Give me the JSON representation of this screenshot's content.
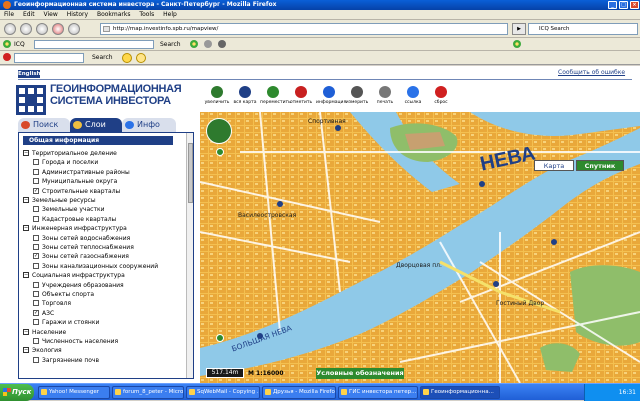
{
  "window": {
    "title": "Геоинформационная система инвестора - Санкт-Петербург - Mozilla Firefox"
  },
  "menu": [
    "File",
    "Edit",
    "View",
    "History",
    "Bookmarks",
    "Tools",
    "Help"
  ],
  "nav": {
    "url": "http://map.investinfo.spb.ru/mapview/",
    "search_placeholder": "ICQ Search"
  },
  "icq_bar": {
    "label": "ICQ",
    "search_label": "Search"
  },
  "bar3": {
    "search_label": "Search"
  },
  "page": {
    "english_label": "English",
    "report_error": "Сообщить об ошибке",
    "logo_line1": "ГЕОИНФОРМАЦИОННАЯ",
    "logo_line2": "СИСТЕМА ИНВЕСТОРА"
  },
  "tabs": [
    {
      "label": "Поиск",
      "active": false
    },
    {
      "label": "Слои",
      "active": true
    },
    {
      "label": "Инфо",
      "active": false
    }
  ],
  "layers": {
    "header": "Общая информация",
    "groups": [
      {
        "label": "Территориальное деление",
        "items": [
          {
            "label": "Города и поселки",
            "checked": false
          },
          {
            "label": "Административные районы",
            "checked": false
          },
          {
            "label": "Муниципальные округа",
            "checked": false
          },
          {
            "label": "Строительные кварталы",
            "checked": true
          }
        ]
      },
      {
        "label": "Земельные ресурсы",
        "items": [
          {
            "label": "Земельные участки",
            "checked": false
          },
          {
            "label": "Кадастровые кварталы",
            "checked": false
          }
        ]
      },
      {
        "label": "Инженерная инфраструктура",
        "items": [
          {
            "label": "Зоны сетей водоснабжения",
            "checked": false
          },
          {
            "label": "Зоны сетей теплоснабжения",
            "checked": false
          },
          {
            "label": "Зоны сетей газоснабжения",
            "checked": true
          },
          {
            "label": "Зоны канализационных сооружений",
            "checked": false
          }
        ]
      },
      {
        "label": "Социальная инфраструктура",
        "items": [
          {
            "label": "Учреждения образования",
            "checked": false
          },
          {
            "label": "Объекты спорта",
            "checked": false
          },
          {
            "label": "Торговля",
            "checked": false
          },
          {
            "label": "АЗС",
            "checked": true
          },
          {
            "label": "Гаражи и стоянки",
            "checked": false
          }
        ]
      },
      {
        "label": "Население",
        "items": [
          {
            "label": "Численность населения",
            "checked": false
          }
        ]
      },
      {
        "label": "Экология",
        "items": [
          {
            "label": "Загрязнение почв",
            "checked": false
          }
        ]
      }
    ]
  },
  "map_tools": [
    {
      "label": "увеличить",
      "icon": "zoom-in-icon",
      "color": "#2e7a2e"
    },
    {
      "label": "вся карта",
      "icon": "full-map-icon",
      "color": "#1f3f86"
    },
    {
      "label": "переместить",
      "icon": "pan-icon",
      "color": "#2e8a2e"
    },
    {
      "label": "отметить",
      "icon": "marker-icon",
      "color": "#c82020"
    },
    {
      "label": "информация",
      "icon": "info-icon",
      "color": "#1f5fd6"
    },
    {
      "label": "измерить",
      "icon": "measure-icon",
      "color": "#555555"
    },
    {
      "label": "печать",
      "icon": "print-icon",
      "color": "#777777"
    },
    {
      "label": "ссылка",
      "icon": "link-icon",
      "color": "#2a72e8"
    },
    {
      "label": "сброс",
      "icon": "reset-icon",
      "color": "#d02020"
    }
  ],
  "map": {
    "type_buttons": {
      "map": "Карта",
      "satellite": "Спутник"
    },
    "scale_bar": "517.14m",
    "scale": "М 1:16000",
    "legend_button": "Условные обозначения",
    "labels": {
      "neva": "НЕВА",
      "bolshaya_neva": "БОЛЬШАЯ НЕВА",
      "sportivnaya": "Спортивная",
      "vasileostrovskaya": "Василеостровская",
      "dvortsovaya": "Дворцовая пл.",
      "gostiny_dvor": "Гостиный Двор"
    }
  },
  "taskbar": {
    "start": "Пуск",
    "tasks": [
      {
        "label": "Yahoo! Messenger",
        "active": false
      },
      {
        "label": "forum_8_peter - Micros...",
        "active": false
      },
      {
        "label": "SqWebMail - Copying ...",
        "active": false
      },
      {
        "label": "Друзья - Mozilla Firefox",
        "active": false
      },
      {
        "label": "ГИС инвестора петер...",
        "active": false
      },
      {
        "label": "Геоинформационна...",
        "active": true
      }
    ],
    "clock": "16:31"
  }
}
